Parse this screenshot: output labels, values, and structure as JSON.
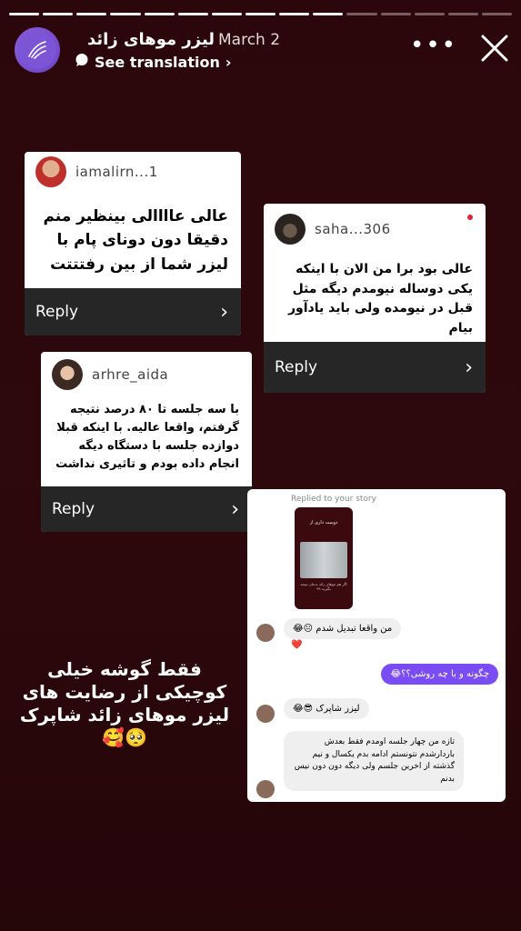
{
  "story": {
    "progress_total": 15,
    "progress_done": 10
  },
  "header": {
    "account_name": "لیزر موهای زائد",
    "date": "March 2",
    "see_translation": "See translation",
    "more": "•••"
  },
  "comments": [
    {
      "username": "iamalirn...1",
      "text": "عالی عاااالی بینظیر منم دقیقا دون دونای پام با لیزر شما  از بین رفتتتت",
      "reply": "Reply"
    },
    {
      "username": "saha...306",
      "text": "عالی بود برا من الان با اینکه یکی دوساله نیومدم دیگه مثل قبل در نیومده ولی باید یادآور بیام",
      "reply": "Reply"
    },
    {
      "username": "arhre_aida",
      "text": "با سه جلسه تا ۸۰ درصد نتیجه گرفتم، واقعا عالیه. با اینکه قبلا دوازده جلسه با دستگاه دیگه انجام داده بودم و تاثیری نداشت",
      "reply": "Reply"
    }
  ],
  "dm": {
    "replied_to": "Replied to your story",
    "story_title": "دوست داری از",
    "story_caption": "اگر هم موهای زائد بدنتان نتیجه بگیرید ۹۹",
    "messages": [
      {
        "from": "them",
        "text": "من واقعا تبدیل شدم 😐😂"
      },
      {
        "from": "me",
        "text": "چگونه و با چه روشی؟؟😂"
      },
      {
        "from": "them",
        "text": "لیزر شاپرک 😎😂"
      },
      {
        "from": "them",
        "text": "تازه من چهار جلسه اومدم فقط بعدش باردارشدم نتونستم ادامه بدم یکسال و نیم گذشته از اخرین جلسم ولی دیگه دون دون نیس بدنم"
      }
    ],
    "heart": "❤️"
  },
  "caption": "فقط گوشه خیلی کوچیکی از رضایت های لیزر موهای زائد شاپرک🥺🥰",
  "colors": {
    "background": "#2a070b",
    "reply_bar": "#262626",
    "dm_out_bubble": "#7a4cf3",
    "avatar": "#7b55d6"
  },
  "icons": [
    "avatar-logo-icon",
    "translate-bubble-icon",
    "chevron-right-icon",
    "more-icon",
    "close-icon"
  ]
}
